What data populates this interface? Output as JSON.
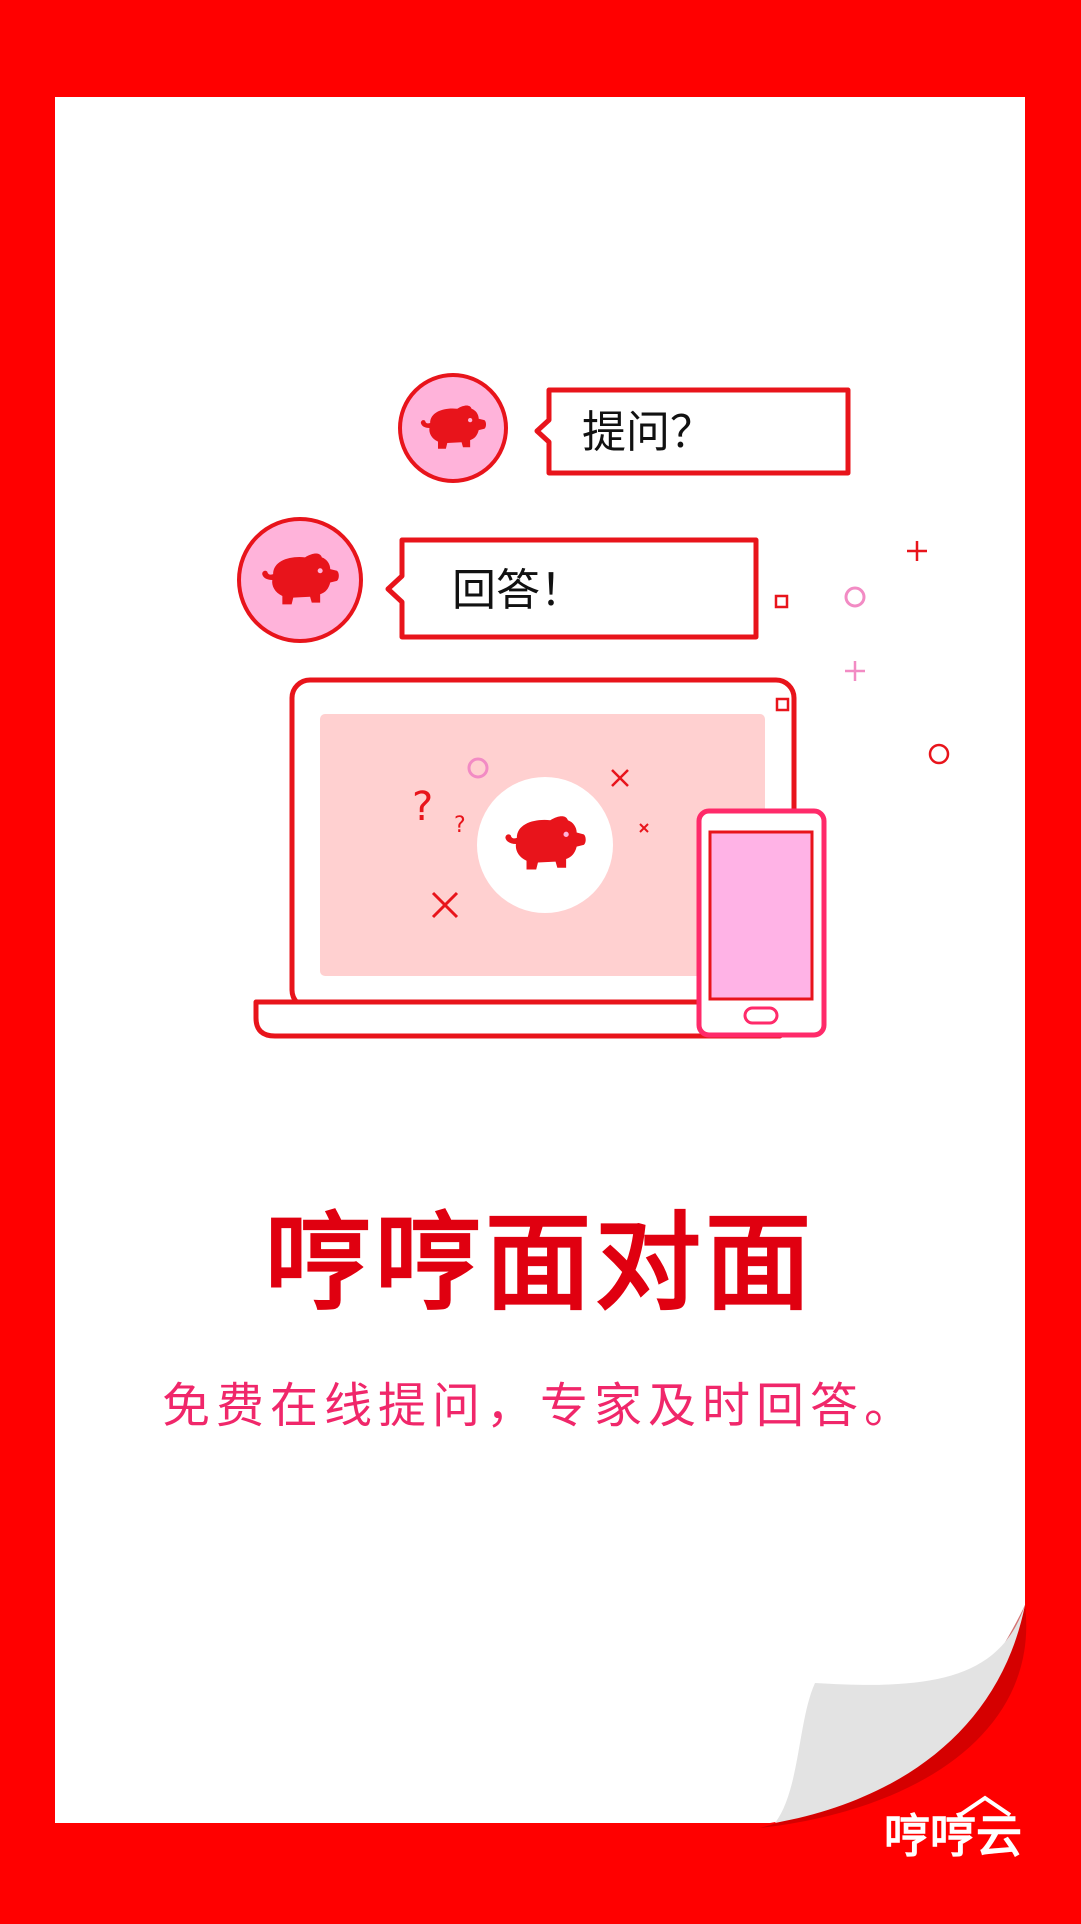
{
  "bubbles": {
    "question": "提问？",
    "answer": "回答！"
  },
  "headline": "哼哼面对面",
  "subline": "免费在线提问，专家及时回答。",
  "brand": {
    "name": "哼哼云"
  },
  "colors": {
    "frame": "#ff0000",
    "paper": "#ffffff",
    "accent_red": "#e8141b",
    "pink_fill": "#ffb3da",
    "screen_fill": "#ffd0d0",
    "subline": "#f0276a"
  },
  "icons": [
    "pig-icon",
    "laptop-icon",
    "phone-icon",
    "question-mark-icon",
    "cross-icon",
    "circle-decoration",
    "plus-decoration",
    "square-decoration",
    "page-curl"
  ]
}
